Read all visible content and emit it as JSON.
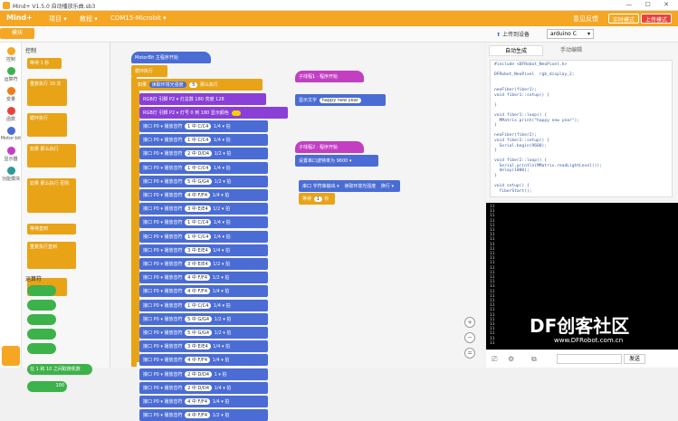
{
  "title": "Mind+ V1.5.0   自动播放乐曲.sb3",
  "topbar": {
    "brand": "Mind+",
    "menu": [
      "项目 ▾",
      "教程 ▾",
      "COM15-Microbit ▾"
    ],
    "feedback": "意见反馈",
    "mode1": "实时模式",
    "mode2": "上传模式"
  },
  "toolbar": {
    "tab": "模块",
    "upload": "上传到设备",
    "board": "arduino C"
  },
  "code_tabs": {
    "auto": "自动生成",
    "manual": "手动编辑"
  },
  "categories": [
    {
      "label": "控制",
      "color": "#f5a623"
    },
    {
      "label": "运算符",
      "color": "#3db24a"
    },
    {
      "label": "变量",
      "color": "#f07c18"
    },
    {
      "label": "函数",
      "color": "#e8433b"
    },
    {
      "label": "Motor:bit",
      "color": "#4a6cd4"
    },
    {
      "label": "显示器",
      "color": "#c23fc2"
    },
    {
      "label": "功能模块",
      "color": "#2a9b9b"
    }
  ],
  "flyout": {
    "title": "控制",
    "items": [
      "等待 1 秒",
      "重复执行 10 次",
      "循环执行",
      "如果 那么执行",
      "如果 那么执行 否则",
      "等待直到",
      "重复执行直到"
    ],
    "op_title": "运算符",
    "op_items": [
      "",
      "",
      "",
      "",
      "",
      "在 1 和 10 之间取随机数",
      "100"
    ]
  },
  "ws": {
    "hat_main": "MotorBit 主程序开始",
    "loop": "循环执行",
    "if": "如果",
    "if_read": "读取环境光强度",
    "if_val": "5",
    "if_then": "那么执行",
    "rgb1": "RGB灯 引脚  P2 ▾  灯总数 180  亮度 128",
    "rgb2": "RGB灯 引脚  P2 ▾  灯号 0  到 180  显示颜色",
    "notes": [
      [
        "接口 P0 ▾ 播放音符",
        "1 中 C/C4",
        "1/4 ▾ 拍"
      ],
      [
        "接口 P0 ▾ 播放音符",
        "1 中 C/C4",
        "1/4 ▾ 拍"
      ],
      [
        "接口 P0 ▾ 播放音符",
        "2 中 D/D4",
        "1/2 ▾ 拍"
      ],
      [
        "接口 P0 ▾ 播放音符",
        "1 中 C/C4",
        "1/4 ▾ 拍"
      ],
      [
        "接口 P0 ▾ 播放音符",
        "5 中 G/G4",
        "1/2 ▾ 拍"
      ],
      [
        "接口 P0 ▾ 播放音符",
        "4 中 F/F4",
        "1/4 ▾ 拍"
      ],
      [
        "接口 P0 ▾ 播放音符",
        "3 中 E/E4",
        "1/2 ▾ 拍"
      ],
      [
        "接口 P0 ▾ 播放音符",
        "1 中 C/C4",
        "1/4 ▾ 拍"
      ],
      [
        "接口 P0 ▾ 播放音符",
        "1 中 C/C4",
        "1/4 ▾ 拍"
      ],
      [
        "接口 P0 ▾ 播放音符",
        "3 中 E/E4",
        "1/4 ▾ 拍"
      ],
      [
        "接口 P0 ▾ 播放音符",
        "3 中 E/E4",
        "1/2 ▾ 拍"
      ],
      [
        "接口 P0 ▾ 播放音符",
        "4 中 F/F4",
        "1/2 ▾ 拍"
      ],
      [
        "接口 P0 ▾ 播放音符",
        "4 中 F/F4",
        "1/4 ▾ 拍"
      ],
      [
        "接口 P0 ▾ 播放音符",
        "1 中 C/C4",
        "1/4 ▾ 拍"
      ],
      [
        "接口 P0 ▾ 播放音符",
        "5 中 G/G4",
        "1/2 ▾ 拍"
      ],
      [
        "接口 P0 ▾ 播放音符",
        "5 中 G/G4",
        "1/2 ▾ 拍"
      ],
      [
        "接口 P0 ▾ 播放音符",
        "3 中 E/E4",
        "1/4 ▾ 拍"
      ],
      [
        "接口 P0 ▾ 播放音符",
        "4 中 F/F4",
        "1/4 ▾ 拍"
      ],
      [
        "接口 P0 ▾ 播放音符",
        "2 中 D/D4",
        "1 ▾ 拍"
      ],
      [
        "接口 P0 ▾ 播放音符",
        "2 中 D/D4",
        "1/4 ▾ 拍"
      ],
      [
        "接口 P0 ▾ 播放音符",
        "4 中 F/F4",
        "1/4 ▾ 拍"
      ],
      [
        "接口 P0 ▾ 播放音符",
        "4 中 F/F4",
        "1/2 ▾ 拍"
      ]
    ],
    "thread1": "子线程1 · 程序开始",
    "show_text": "显示文字",
    "hello": "happy new year",
    "thread2": "子线程2 · 程序开始",
    "baud": "设置串口波特率为  9600 ▾",
    "serial": "串口  字符串输出 ▾",
    "serial_read": "读取环境光强度",
    "wrap": "换行 ▾",
    "wait": "等待",
    "wait_v": "1",
    "wait_u": "秒"
  },
  "code_lines": [
    "#include <DFRobot_NeoPixel.h>",
    "",
    "DFRobot_NeoPixel  rgb_display_2;",
    "",
    "",
    "neoFiber(fiber1);",
    "void fiber1::setup() {",
    "",
    "}",
    "",
    "void fiber1::loop() {",
    "  MMatrix.print(\"happy new year\");",
    "}",
    "",
    "neoFiber(fiber2);",
    "void fiber2::setup() {",
    "  Serial.begin(9600);",
    "}",
    "",
    "void fiber2::loop() {",
    "  Serial.println(MMatrix.readLightLevel());",
    "  delay(1000);",
    "}",
    "",
    "void setup() {",
    "  fiberStart();"
  ],
  "console_lines": [
    "11",
    "11",
    "11",
    "11",
    "11",
    "11",
    "11",
    "11",
    "11",
    "11",
    "11",
    "11",
    "11",
    "11",
    "11",
    "11",
    "11",
    "11",
    "11",
    "11",
    "11",
    "11",
    "11",
    "11",
    "11",
    "11",
    "11",
    "11",
    "11",
    "11"
  ],
  "bottom": {
    "send": "发送"
  },
  "watermark": {
    "main": "DF创客社区",
    "url": "www.DFRobot.com.cn"
  }
}
